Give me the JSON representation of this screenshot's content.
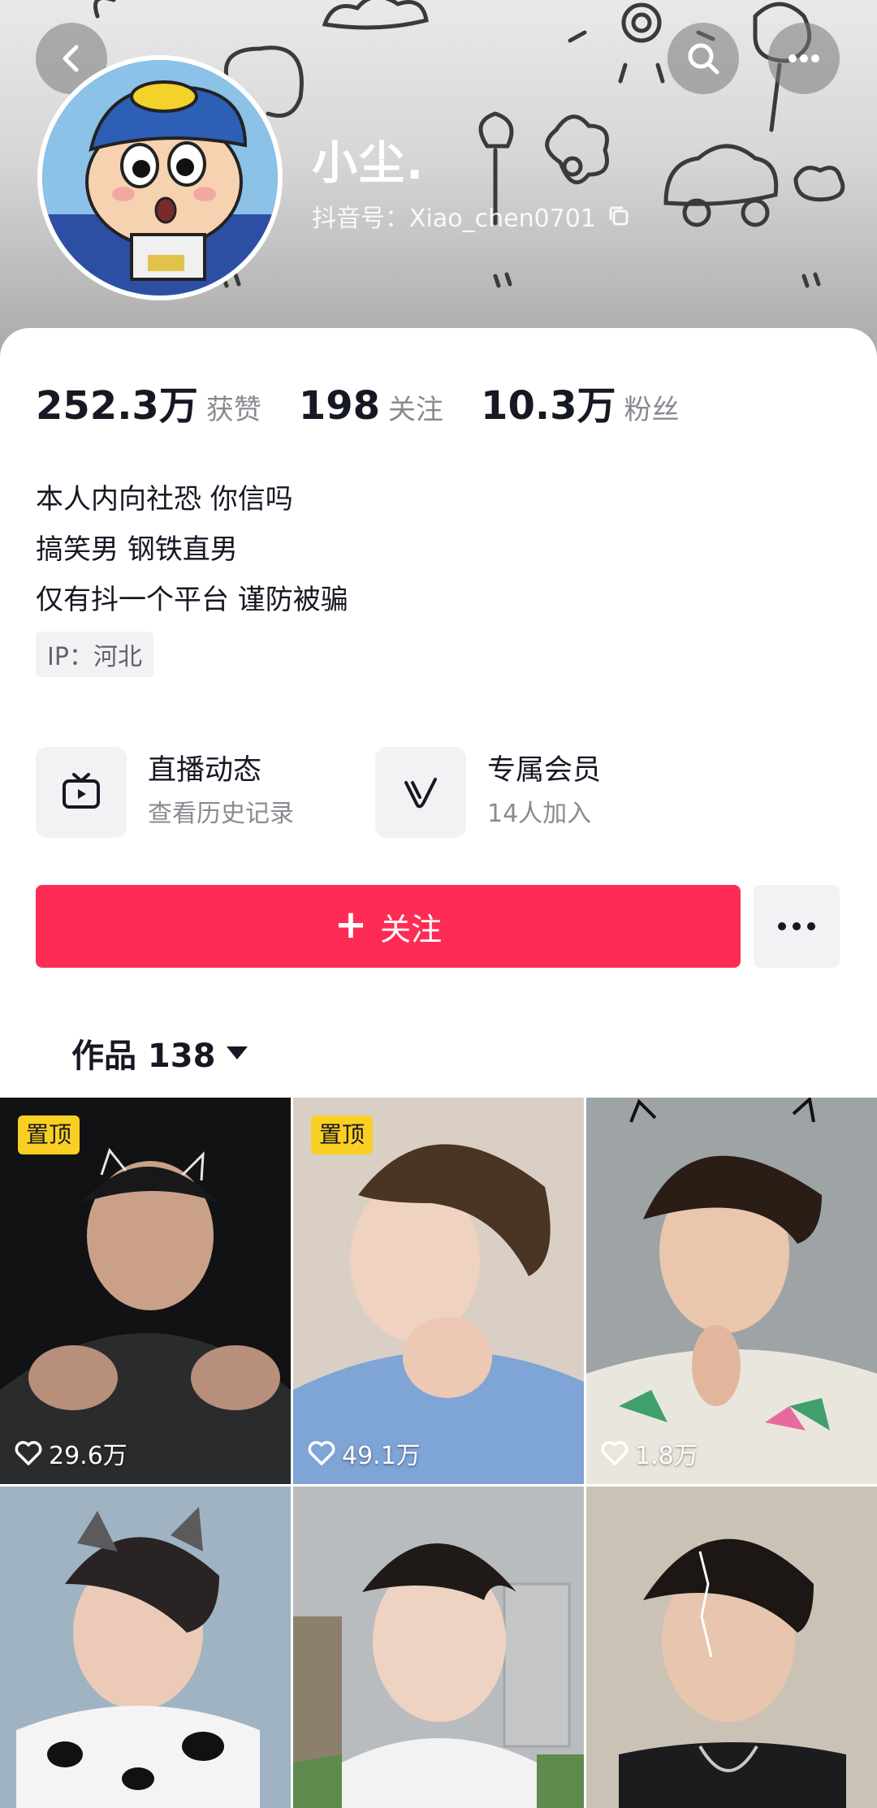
{
  "header": {
    "nickname": "小尘.",
    "douyin_id": "抖音号：Xiao_chen0701",
    "back_icon": "chevron-left-icon",
    "search_icon": "search-icon",
    "more_icon": "more-dots-icon"
  },
  "stats": [
    {
      "value": "252.3万",
      "label": "获赞"
    },
    {
      "value": "198",
      "label": "关注"
    },
    {
      "value": "10.3万",
      "label": "粉丝"
    }
  ],
  "bio": {
    "lines": [
      "本人内向社恐 你信吗",
      "搞笑男 钢铁直男",
      "仅有抖一个平台 谨防被骗"
    ],
    "ip": "IP：河北"
  },
  "features": [
    {
      "title": "直播动态",
      "subtitle": "查看历史记录",
      "icon": "tv-icon"
    },
    {
      "title": "专属会员",
      "subtitle": "14人加入",
      "icon": "v-badge-icon"
    }
  ],
  "actions": {
    "follow_label": "关注",
    "accent_color": "#fe2c55"
  },
  "works": {
    "tab_label": "作品 138"
  },
  "videos": [
    {
      "pinned": "置顶",
      "likes": "29.6万"
    },
    {
      "pinned": "置顶",
      "likes": "49.1万"
    },
    {
      "pinned": "",
      "likes": "1.8万"
    },
    {
      "pinned": "",
      "likes": ""
    },
    {
      "pinned": "",
      "likes": ""
    },
    {
      "pinned": "",
      "likes": ""
    }
  ]
}
